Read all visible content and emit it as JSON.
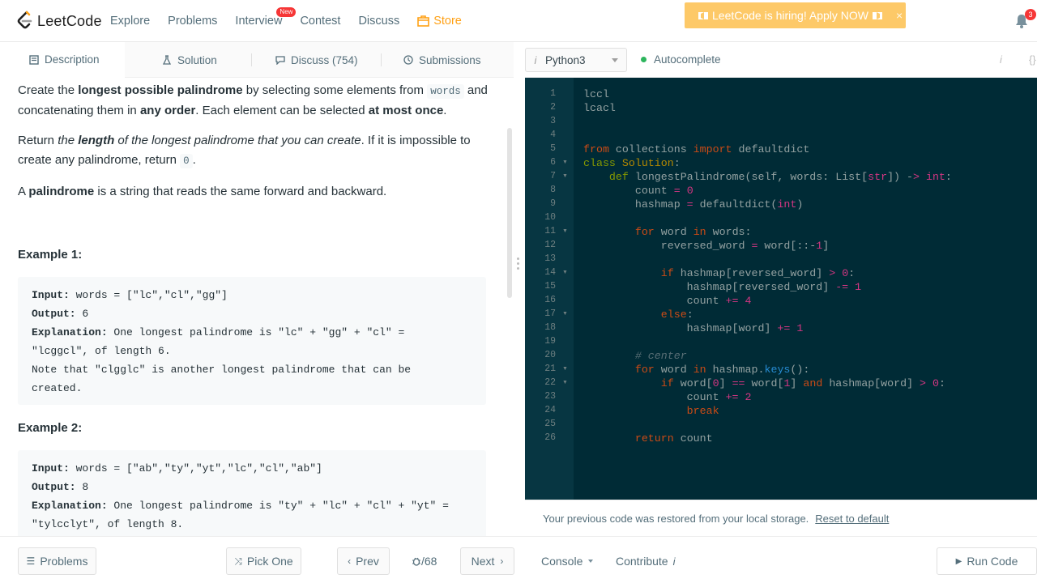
{
  "nav": {
    "logo_text": "LeetCode",
    "items": [
      {
        "label": "Explore"
      },
      {
        "label": "Problems"
      },
      {
        "label": "Interview",
        "badge": "New"
      },
      {
        "label": "Contest"
      },
      {
        "label": "Discuss"
      },
      {
        "label": "Store"
      }
    ],
    "hiring_banner": "LeetCode is hiring! Apply NOW",
    "hiring_close": "×",
    "notification_count": "3"
  },
  "tabs": [
    {
      "label": "Description"
    },
    {
      "label": "Solution"
    },
    {
      "label": "Discuss (754)"
    },
    {
      "label": "Submissions"
    }
  ],
  "description": {
    "p1": {
      "a": "Create the ",
      "b": "longest possible palindrome",
      "c": " by selecting some elements from ",
      "code": "words",
      "d": " and concatenating them in ",
      "e": "any order",
      "f": ". Each element can be selected ",
      "g": "at most once",
      "h": "."
    },
    "p2": {
      "a": "Return ",
      "b_i": "the ",
      "b_bi": "length",
      "b_i2": " of the longest palindrome that you can create",
      "c": ". If it is impossible to create any palindrome, return ",
      "code": "0",
      "d": "."
    },
    "p3": {
      "a": "A ",
      "b": "palindrome",
      "c": " is a string that reads the same forward and backward."
    },
    "examples": [
      {
        "title": "Example 1:",
        "input_label": "Input:",
        "input": " words = [\"lc\",\"cl\",\"gg\"]",
        "output_label": "Output:",
        "output": " 6",
        "explanation_label": "Explanation:",
        "explanation_lines": [
          " One longest palindrome is \"lc\" + \"gg\" + \"cl\" =",
          "\"lcggcl\", of length 6.",
          "Note that \"clgglc\" is another longest palindrome that can be",
          "created."
        ]
      },
      {
        "title": "Example 2:",
        "input_label": "Input:",
        "input": " words = [\"ab\",\"ty\",\"yt\",\"lc\",\"cl\",\"ab\"]",
        "output_label": "Output:",
        "output": " 8",
        "explanation_label": "Explanation:",
        "explanation_lines": [
          " One longest palindrome is \"ty\" + \"lc\" + \"cl\" + \"yt\" =",
          "\"tylcclyt\", of length 8."
        ]
      }
    ]
  },
  "editor": {
    "language": "Python3",
    "language_info": "i",
    "autocomplete_label": "Autocomplete",
    "toolbar_info": "i",
    "toolbar_braces": "{}",
    "line_numbers": [
      "1",
      "2",
      "3",
      "4",
      "5",
      "6",
      "7",
      "8",
      "9",
      "10",
      "11",
      "12",
      "13",
      "14",
      "15",
      "16",
      "17",
      "18",
      "19",
      "20",
      "21",
      "22",
      "23",
      "24",
      "25",
      "26"
    ],
    "fold_lines": [
      "6",
      "7",
      "11",
      "14",
      "17",
      "21",
      "22"
    ],
    "code_lines": [
      "lccl",
      "lcacl",
      "",
      "",
      "from collections import defaultdict",
      "class Solution:",
      "    def longestPalindrome(self, words: List[str]) -> int:",
      "        count = 0",
      "        hashmap = defaultdict(int)",
      "",
      "        for word in words:",
      "            reversed_word = word[::-1]",
      "",
      "            if hashmap[reversed_word] > 0:",
      "                hashmap[reversed_word] -= 1",
      "                count += 4",
      "            else:",
      "                hashmap[word] += 1",
      "",
      "        # center",
      "        for word in hashmap.keys():",
      "            if word[0] == word[1] and hashmap[word] > 0:",
      "                count += 2",
      "                break",
      "",
      "        return count"
    ],
    "restore_text": "Your previous code was restored from your local storage.",
    "reset_link": "Reset to default"
  },
  "bottom": {
    "problems": "Problems",
    "pick_one": "Pick One",
    "prev": "Prev",
    "page": "/68",
    "next": "Next",
    "console": "Console",
    "contribute": "Contribute",
    "contribute_info": "i",
    "run_code": "Run Code"
  },
  "colors": {
    "accent": "#ffa116",
    "banner": "#fdc968",
    "editor_bg": "#002b36",
    "gutter_bg": "#073642",
    "badge_red": "#f63636",
    "status_green": "#2db55d"
  }
}
